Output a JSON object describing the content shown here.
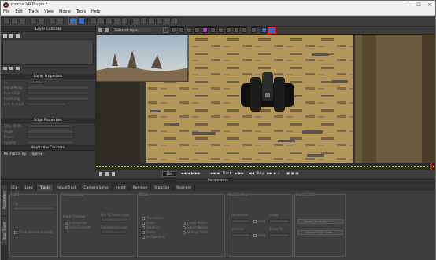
{
  "window": {
    "title": "mocha VR Plugin *",
    "minimize": "—",
    "maximize": "☐",
    "close": "✕"
  },
  "menu": [
    "File",
    "Edit",
    "Track",
    "View",
    "Movie",
    "Tools",
    "Help"
  ],
  "left_panel": {
    "layer_controls_title": "Layer Controls",
    "layer_properties_title": "Layer Properties",
    "layer_props": [
      "In",
      "Out",
      "Blend Mode",
      "Insert Clip",
      "Insert Clip",
      "Link to track"
    ],
    "edge_properties_title": "Edge Properties",
    "edge_props": [
      "Edge Width",
      "Angle",
      "Phase",
      "Opacity"
    ],
    "keyframe_title": "Keyframe Controls",
    "keyframe_by_label": "Keyframe by",
    "keyframe_by_value": "Spline"
  },
  "viewer_toolbar": {
    "layer_select": "Selected layer"
  },
  "playbar": {
    "frame": "150",
    "track_label": "Track",
    "key_label": "Key"
  },
  "parameters": {
    "title": "Parameters",
    "tabs": [
      "Clip",
      "Lens",
      "Track",
      "AdjustTrack",
      "Camera Solve",
      "Insert",
      "Remove",
      "Stabilize",
      "Reorient"
    ],
    "active_tab": "Track",
    "side_tabs": [
      "Parameters",
      "Dope Sheet"
    ],
    "groups": {
      "input": "Input",
      "preprocessing": "Preprocessing",
      "motion": "Motion",
      "search_area": "Search Area",
      "export_data": "Export Data"
    },
    "labels": {
      "clip": "Clip",
      "track_individual_fields": "Track individual fields",
      "input_channel": "Input Channel",
      "luminance": "Luminance",
      "auto_channel": "Auto Channel",
      "min_pixels_used": "Min % Pixels Used",
      "smoothing_level": "Smoothing Level",
      "translation": "Translation",
      "scale": "Scale",
      "rotation": "Rotation",
      "shear": "Shear",
      "perspective": "Perspective",
      "large_motion": "Large Motion",
      "small_motion": "Small Motion",
      "manual_track": "Manual Track",
      "horizontal": "Horizontal",
      "vertical": "Vertical",
      "angle": "Angle",
      "zoom": "Zoom %",
      "auto": "Auto",
      "export_tracking_data": "Export Tracking Data...",
      "export_shape_data": "Export Shape Data..."
    }
  }
}
